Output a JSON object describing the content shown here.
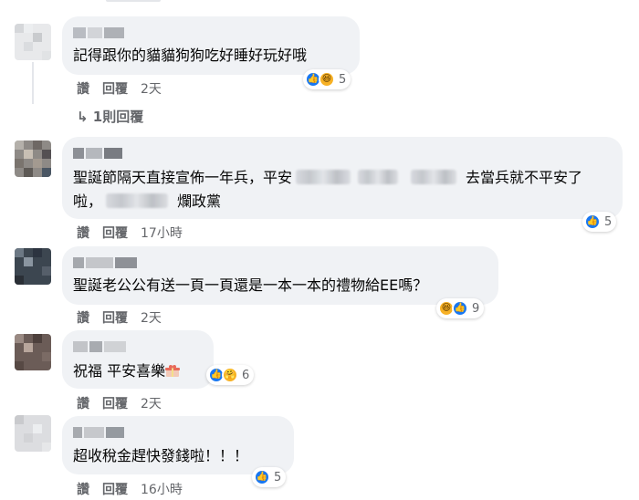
{
  "comments": [
    {
      "text": "記得跟你的貓貓狗狗吃好睡好玩好哦",
      "actions": {
        "like": "讚",
        "reply": "回覆",
        "time": "2天"
      },
      "reactions": {
        "icons": [
          "like-icon",
          "haha-icon"
        ],
        "count": "5"
      },
      "replies_label": "1則回覆"
    },
    {
      "text_line1_a": "聖誕節隔天直接宣佈一年兵，平安",
      "text_line1_b": "去當兵就不平安了",
      "text_line2_a": "啦，",
      "text_line2_b": "爛政黨",
      "actions": {
        "like": "讚",
        "reply": "回覆",
        "time": "17小時"
      },
      "reactions": {
        "icons": [
          "like-icon"
        ],
        "count": "5"
      }
    },
    {
      "text": "聖誕老公公有送一頁一頁還是一本一本的禮物給EE嗎？",
      "actions": {
        "like": "讚",
        "reply": "回覆",
        "time": "2天"
      },
      "reactions": {
        "icons": [
          "haha-icon",
          "like-icon"
        ],
        "count": "9"
      }
    },
    {
      "text": "祝福 平安喜樂",
      "actions": {
        "like": "讚",
        "reply": "回覆",
        "time": "2天"
      },
      "reactions": {
        "icons": [
          "like-icon",
          "care-icon"
        ],
        "count": "6"
      }
    },
    {
      "text": "超收稅金趕快發錢啦！！！",
      "actions": {
        "like": "讚",
        "reply": "回覆",
        "time": "16小時"
      },
      "reactions": {
        "icons": [
          "like-icon"
        ],
        "count": "5"
      }
    }
  ],
  "colors": {
    "bubble": "#f0f2f5",
    "like": "#1877f2",
    "secondary_text": "#65676b"
  }
}
